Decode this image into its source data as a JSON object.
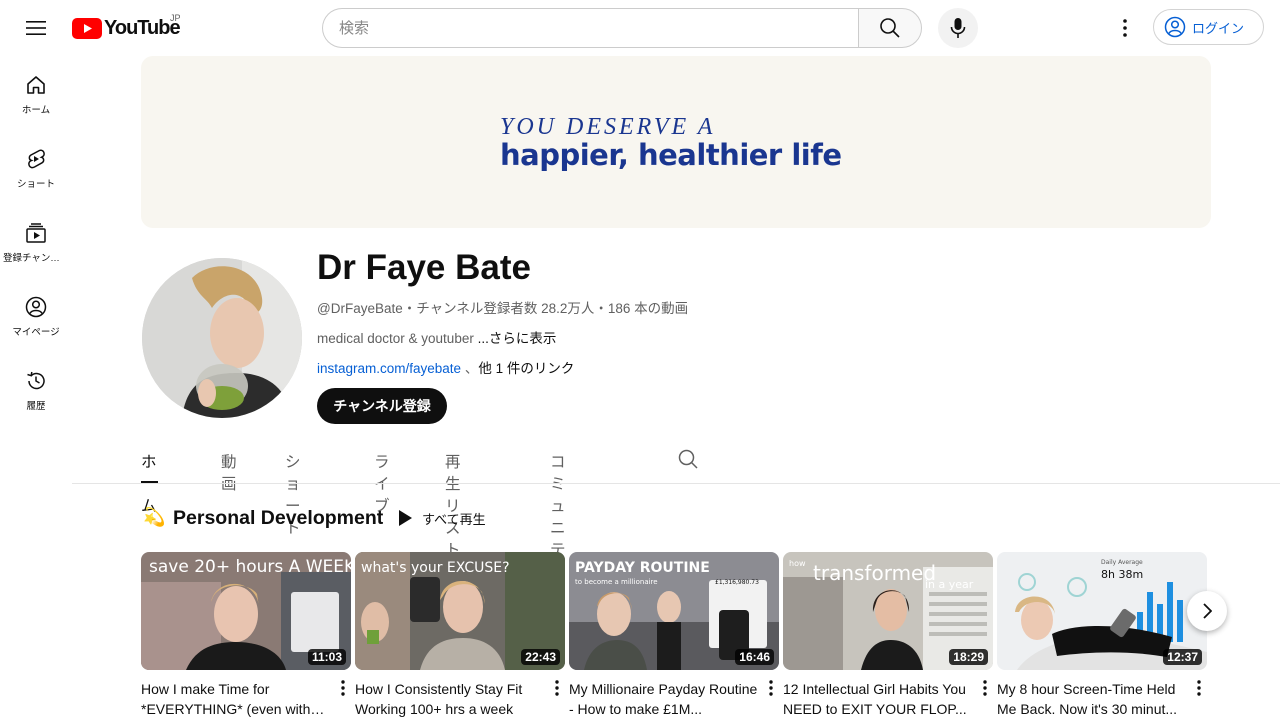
{
  "header": {
    "logo_text": "YouTube",
    "region": "JP",
    "search_placeholder": "検索",
    "login_label": "ログイン"
  },
  "sidebar": {
    "items": [
      {
        "label": "ホーム",
        "icon": "home-icon"
      },
      {
        "label": "ショート",
        "icon": "shorts-icon"
      },
      {
        "label": "登録チャンネル",
        "icon": "subscriptions-icon"
      },
      {
        "label": "マイページ",
        "icon": "account-icon"
      },
      {
        "label": "履歴",
        "icon": "history-icon"
      }
    ]
  },
  "banner": {
    "line1": "YOU DESERVE A",
    "line2": "happier, healthier life",
    "color": "#1a3690"
  },
  "channel": {
    "name": "Dr Faye Bate",
    "meta": "@DrFayeBate・チャンネル登録者数 28.2万人・186 本の動画",
    "description": "medical doctor & youtuber ",
    "more_label": "...さらに表示",
    "link_text": "instagram.com/fayebate",
    "link_suffix": " 、",
    "other_links": "他 1 件のリンク",
    "subscribe_label": "チャンネル登録"
  },
  "tabs": [
    "ホーム",
    "動画",
    "ショート",
    "ライブ",
    "再生リスト",
    "コミュニティ"
  ],
  "section": {
    "icon": "💫",
    "title": "Personal Development",
    "play_all_label": "すべて再生"
  },
  "videos": [
    {
      "title": "How I make Time for *EVERYTHING* (even with a...",
      "duration": "11:03",
      "thumb_text": "save 20+ hours A WEEK"
    },
    {
      "title": "How I Consistently Stay Fit Working 100+ hrs a week",
      "duration": "22:43",
      "thumb_text": "what's your EXCUSE?"
    },
    {
      "title": "My Millionaire Payday Routine - How to make £1M...",
      "duration": "16:46",
      "thumb_text": "PAYDAY ROUTINE",
      "thumb_sub": "to become a millionaire",
      "thumb_amount": "£1,316,980.73"
    },
    {
      "title": "12 Intellectual Girl Habits You NEED to EXIT YOUR FLOP...",
      "duration": "18:29",
      "thumb_text": "transformed",
      "thumb_sub": "in a year",
      "thumb_pre": "how"
    },
    {
      "title": "My 8 hour Screen-Time Held Me Back. Now it's 30 minut...",
      "duration": "12:37",
      "thumb_text": "8h 38m",
      "thumb_sub": "Daily Average"
    }
  ]
}
